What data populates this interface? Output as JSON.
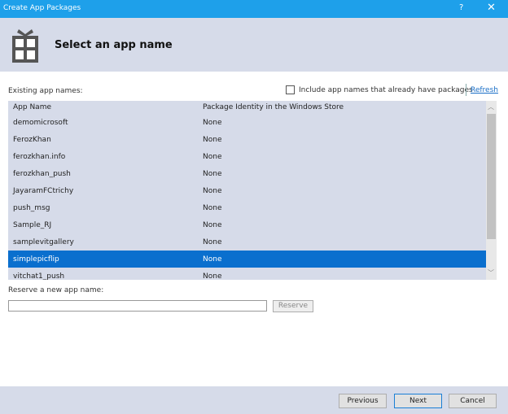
{
  "window": {
    "title": "Create App Packages",
    "help": "?",
    "close": "✕"
  },
  "header": {
    "title": "Select an app name",
    "icon": "gift-icon"
  },
  "existing_label": "Existing app names:",
  "include_label": "Include app names that already have packages",
  "refresh": "Refresh",
  "table": {
    "columns": [
      "App Name",
      "Package Identity in the Windows Store"
    ],
    "rows": [
      {
        "name": "demomicrosoft",
        "identity": "None"
      },
      {
        "name": "FerozKhan",
        "identity": "None"
      },
      {
        "name": "ferozkhan.info",
        "identity": "None"
      },
      {
        "name": "ferozkhan_push",
        "identity": "None"
      },
      {
        "name": "JayaramFCtrichy",
        "identity": "None"
      },
      {
        "name": "push_msg",
        "identity": "None"
      },
      {
        "name": "Sample_RJ",
        "identity": "None"
      },
      {
        "name": "samplevitgallery",
        "identity": "None"
      },
      {
        "name": "simplepicflip",
        "identity": "None",
        "selected": true
      },
      {
        "name": "vitchat1_push",
        "identity": "None"
      }
    ]
  },
  "reserve_label": "Reserve a new app name:",
  "reserve_value": "",
  "reserve_button": "Reserve",
  "buttons": {
    "previous": "Previous",
    "next": "Next",
    "cancel": "Cancel"
  }
}
